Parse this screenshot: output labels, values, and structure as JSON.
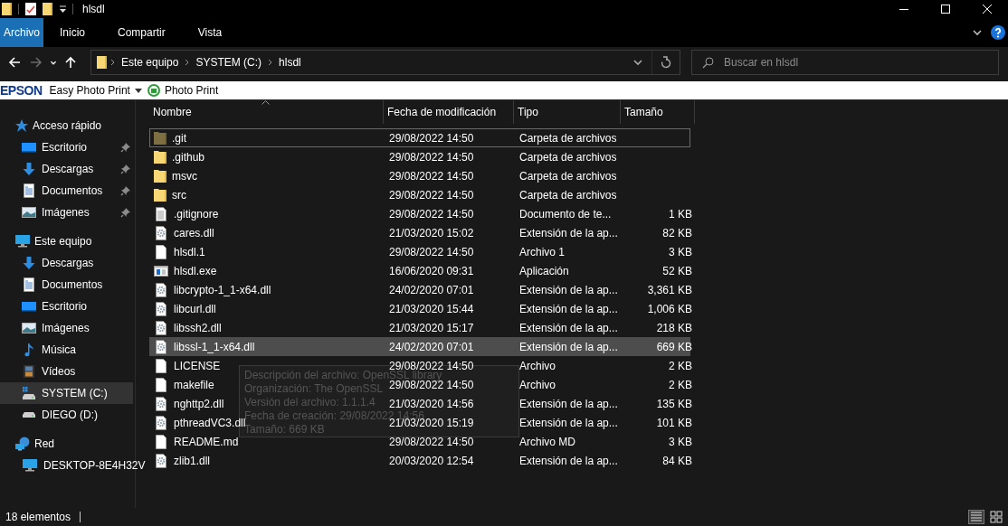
{
  "window": {
    "title": "hlsdl"
  },
  "ribbon": {
    "tabs": [
      {
        "label": "Archivo",
        "selected": true
      },
      {
        "label": "Inicio",
        "selected": false
      },
      {
        "label": "Compartir",
        "selected": false
      },
      {
        "label": "Vista",
        "selected": false
      }
    ]
  },
  "navigation": [
    {
      "kind": "back",
      "disabled": false
    },
    {
      "kind": "forward",
      "disabled": true
    },
    {
      "kind": "recent",
      "disabled": false
    },
    {
      "kind": "up",
      "disabled": false
    }
  ],
  "address": {
    "crumbs": [
      "Este equipo",
      "SYSTEM (C:)",
      "hlsdl"
    ]
  },
  "search": {
    "placeholder": "Buscar en hlsdl"
  },
  "toolbar": {
    "brand": "EPSON",
    "items": [
      {
        "label": "Easy Photo Print",
        "kind": "dropdown"
      },
      {
        "label": "Photo Print",
        "kind": "printer"
      }
    ]
  },
  "sidebar": {
    "items": [
      {
        "label": "Acceso rápido",
        "kind": "star",
        "selected": false,
        "children": [
          {
            "label": "Escritorio",
            "kind": "desktop",
            "pinned": true,
            "selected": false
          },
          {
            "label": "Descargas",
            "kind": "download",
            "pinned": true,
            "selected": false
          },
          {
            "label": "Documentos",
            "kind": "document",
            "pinned": true,
            "selected": false
          },
          {
            "label": "Imágenes",
            "kind": "pictures",
            "pinned": true,
            "selected": false
          }
        ]
      },
      {
        "label": "Este equipo",
        "kind": "computer",
        "selected": false,
        "children": [
          {
            "label": "Descargas",
            "kind": "download",
            "pinned": false,
            "selected": false
          },
          {
            "label": "Documentos",
            "kind": "document",
            "pinned": false,
            "selected": false
          },
          {
            "label": "Escritorio",
            "kind": "desktop",
            "pinned": false,
            "selected": false
          },
          {
            "label": "Imágenes",
            "kind": "pictures",
            "pinned": false,
            "selected": false
          },
          {
            "label": "Música",
            "kind": "music",
            "pinned": false,
            "selected": false
          },
          {
            "label": "Vídeos",
            "kind": "videos",
            "pinned": false,
            "selected": false
          },
          {
            "label": "SYSTEM (C:)",
            "kind": "system-drive",
            "pinned": false,
            "selected": true
          },
          {
            "label": "DIEGO (D:)",
            "kind": "drive",
            "pinned": false,
            "selected": false
          }
        ]
      },
      {
        "label": "Red",
        "kind": "network",
        "selected": false,
        "children": [
          {
            "label": "DESKTOP-8E4H32V",
            "kind": "computer",
            "pinned": false,
            "selected": false
          }
        ]
      }
    ]
  },
  "table": {
    "columns": [
      {
        "label": "Nombre",
        "sorted": true
      },
      {
        "label": "Fecha de modificación",
        "sorted": false
      },
      {
        "label": "Tipo",
        "sorted": false
      },
      {
        "label": "Tamaño",
        "sorted": false
      }
    ],
    "rows": [
      {
        "name": ".git",
        "date": "29/08/2022 14:50",
        "type": "Carpeta de archivos",
        "kind": "folder",
        "hidden": true,
        "selected": false,
        "focused": true
      },
      {
        "name": ".github",
        "date": "29/08/2022 14:50",
        "type": "Carpeta de archivos",
        "kind": "folder",
        "hidden": false,
        "selected": false,
        "focused": false
      },
      {
        "name": "msvc",
        "date": "29/08/2022 14:50",
        "type": "Carpeta de archivos",
        "kind": "folder",
        "hidden": false,
        "selected": false,
        "focused": false
      },
      {
        "name": "src",
        "date": "29/08/2022 14:50",
        "type": "Carpeta de archivos",
        "kind": "folder",
        "hidden": false,
        "selected": false,
        "focused": false
      },
      {
        "name": ".gitignore",
        "date": "29/08/2022 14:50",
        "type": "Documento de te...",
        "size": "1 KB",
        "kind": "text",
        "hidden": false,
        "selected": false,
        "focused": false
      },
      {
        "name": "cares.dll",
        "date": "21/03/2020 15:02",
        "type": "Extensión de la ap...",
        "size": "82 KB",
        "kind": "dll",
        "hidden": false,
        "selected": false,
        "focused": false
      },
      {
        "name": "hlsdl.1",
        "date": "29/08/2022 14:50",
        "type": "Archivo 1",
        "size": "3 KB",
        "kind": "file",
        "hidden": false,
        "selected": false,
        "focused": false
      },
      {
        "name": "hlsdl.exe",
        "date": "16/06/2020 09:31",
        "type": "Aplicación",
        "size": "52 KB",
        "kind": "exe",
        "hidden": false,
        "selected": false,
        "focused": false
      },
      {
        "name": "libcrypto-1_1-x64.dll",
        "date": "24/02/2020 07:01",
        "type": "Extensión de la ap...",
        "size": "3,361 KB",
        "kind": "dll",
        "hidden": false,
        "selected": false,
        "focused": false
      },
      {
        "name": "libcurl.dll",
        "date": "21/03/2020 15:44",
        "type": "Extensión de la ap...",
        "size": "1,006 KB",
        "kind": "dll",
        "hidden": false,
        "selected": false,
        "focused": false
      },
      {
        "name": "libssh2.dll",
        "date": "21/03/2020 15:17",
        "type": "Extensión de la ap...",
        "size": "218 KB",
        "kind": "dll",
        "hidden": false,
        "selected": false,
        "focused": false
      },
      {
        "name": "libssl-1_1-x64.dll",
        "date": "24/02/2020 07:01",
        "type": "Extensión de la ap...",
        "size": "669 KB",
        "kind": "dll",
        "hidden": false,
        "selected": true,
        "focused": false
      },
      {
        "name": "LICENSE",
        "date": "29/08/2022 14:50",
        "type": "Archivo",
        "size": "2 KB",
        "kind": "file",
        "hidden": false,
        "selected": false,
        "focused": false
      },
      {
        "name": "makefile",
        "date": "29/08/2022 14:50",
        "type": "Archivo",
        "size": "2 KB",
        "kind": "file",
        "hidden": false,
        "selected": false,
        "focused": false
      },
      {
        "name": "nghttp2.dll",
        "date": "21/03/2020 14:56",
        "type": "Extensión de la ap...",
        "size": "135 KB",
        "kind": "dll",
        "hidden": false,
        "selected": false,
        "focused": false
      },
      {
        "name": "pthreadVC3.dll",
        "date": "21/03/2020 15:19",
        "type": "Extensión de la ap...",
        "size": "101 KB",
        "kind": "dll",
        "hidden": false,
        "selected": false,
        "focused": false
      },
      {
        "name": "README.md",
        "date": "29/08/2022 14:50",
        "type": "Archivo MD",
        "size": "3 KB",
        "kind": "file",
        "hidden": false,
        "selected": false,
        "focused": false
      },
      {
        "name": "zlib1.dll",
        "date": "20/03/2020 12:54",
        "type": "Extensión de la ap...",
        "size": "84 KB",
        "kind": "dll",
        "hidden": false,
        "selected": false,
        "focused": false
      }
    ]
  },
  "tooltip": {
    "lines": [
      "Descripción del archivo: OpenSSL library",
      "Organización: The OpenSSL",
      "Versión del archivo: 1.1.1.4",
      "Fecha de creación: 29/08/2022 14:56",
      "Tamaño: 669 KB"
    ]
  },
  "status_bar": {
    "count": "18 elementos",
    "views": [
      {
        "kind": "details",
        "selected": true
      },
      {
        "kind": "tiles",
        "selected": false
      }
    ]
  }
}
